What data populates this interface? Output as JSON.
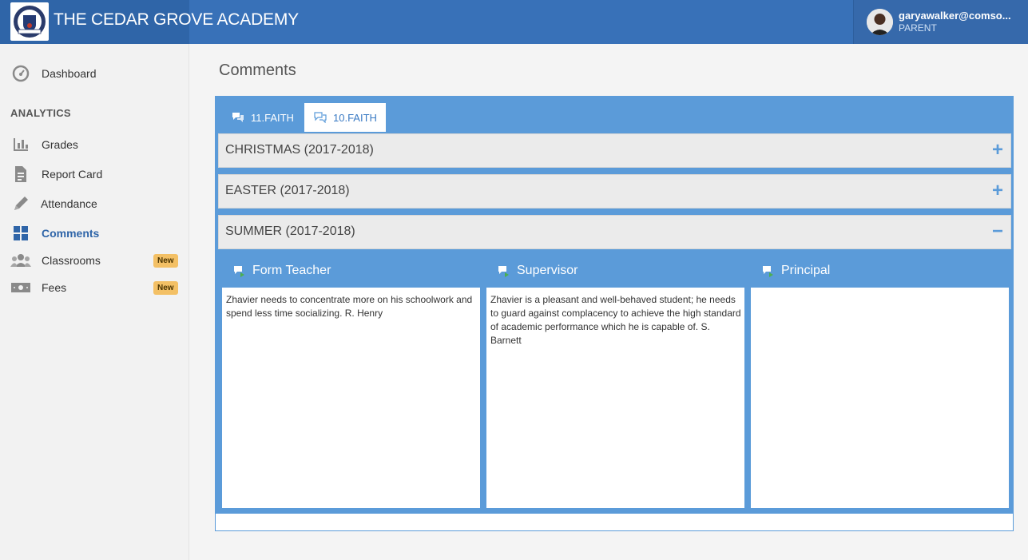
{
  "header": {
    "app_title": "THE CEDAR GROVE ACADEMY",
    "user_email": "garyawalker@comso...",
    "user_role": "PARENT"
  },
  "sidebar": {
    "section_title": "ANALYTICS",
    "items": [
      {
        "label": "Dashboard",
        "icon": "dashboard-icon"
      },
      {
        "label": "Grades",
        "icon": "bar-chart-icon"
      },
      {
        "label": "Report Card",
        "icon": "report-card-icon"
      },
      {
        "label": "Attendance",
        "icon": "pencil-icon"
      },
      {
        "label": "Comments",
        "icon": "grid-icon",
        "active": true
      },
      {
        "label": "Classrooms",
        "icon": "users-icon",
        "badge": "New"
      },
      {
        "label": "Fees",
        "icon": "money-icon",
        "badge": "New"
      }
    ]
  },
  "main": {
    "page_title": "Comments",
    "tabs": [
      {
        "label": "11.FAITH",
        "active": false
      },
      {
        "label": "10.FAITH",
        "active": true
      }
    ],
    "terms": [
      {
        "label": "CHRISTMAS (2017-2018)",
        "toggle": "+"
      },
      {
        "label": "EASTER (2017-2018)",
        "toggle": "+"
      },
      {
        "label": "SUMMER (2017-2018)",
        "toggle": "−"
      }
    ],
    "comments": [
      {
        "title": "Form Teacher",
        "text": "Zhavier needs to concentrate more on his schoolwork and spend less time socializing. R. Henry"
      },
      {
        "title": "Supervisor",
        "text": "Zhavier is a pleasant and well-behaved student; he needs to guard against complacency to achieve the high standard of academic performance which he is capable of. S. Barnett"
      },
      {
        "title": "Principal",
        "text": ""
      }
    ]
  },
  "colors": {
    "header": "#3871b8",
    "accent": "#5b9bd9",
    "badge": "#f3c065"
  }
}
